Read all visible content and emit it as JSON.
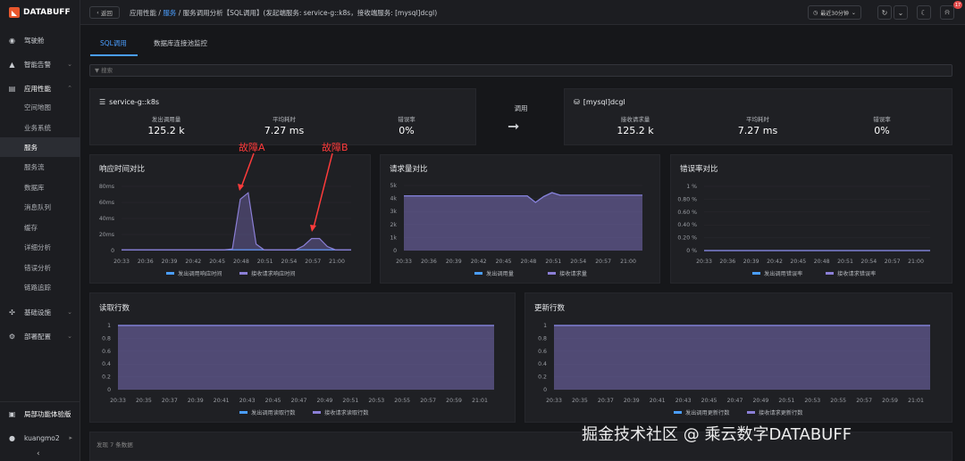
{
  "brand": {
    "name": "DATABUFF",
    "accent": "#e8572d"
  },
  "sidebar": {
    "items": [
      {
        "label": "驾驶舱",
        "icon": "gauge-icon"
      },
      {
        "label": "智能告警",
        "icon": "bell-icon"
      },
      {
        "label": "应用性能",
        "icon": "app-icon"
      },
      {
        "label": "空间地图"
      },
      {
        "label": "业务系统"
      },
      {
        "label": "服务"
      },
      {
        "label": "服务流"
      },
      {
        "label": "数据库"
      },
      {
        "label": "消息队列"
      },
      {
        "label": "缓存"
      },
      {
        "label": "详细分析"
      },
      {
        "label": "错误分析"
      },
      {
        "label": "链路追踪"
      },
      {
        "label": "基础设施",
        "icon": "infra-icon"
      },
      {
        "label": "部署配置",
        "icon": "gear-icon"
      }
    ],
    "trial": "局部功能体验版",
    "user": "kuangmo2"
  },
  "topbar": {
    "back_label": "返回",
    "crumb_1": "应用性能",
    "crumb_sep": "/",
    "crumb_2": "服务",
    "crumb_3": "服务调用分析【SQL调用】(发起端服务: service-g::k8s，接收端服务: [mysql]dcgl)",
    "time_range": "最近30分钟",
    "notif_count": "17"
  },
  "tabs": [
    {
      "label": "SQL调用"
    },
    {
      "label": "数据库连接池监控"
    }
  ],
  "search_placeholder": "搜索",
  "caller": {
    "name": "service-g::k8s",
    "m1_label": "发出调用量",
    "m1_value": "125.2 k",
    "m2_label": "平均耗时",
    "m2_value": "7.27 ms",
    "m3_label": "错误率",
    "m3_value": "0%"
  },
  "call_label": "调用",
  "callee": {
    "name": "[mysql]dcgl",
    "m1_label": "接收请求量",
    "m1_value": "125.2 k",
    "m2_label": "平均耗时",
    "m2_value": "7.27 ms",
    "m3_label": "错误率",
    "m3_value": "0%"
  },
  "annotations": {
    "a": "故障A",
    "b": "故障B"
  },
  "footer_note": "发现 7 条数据",
  "watermark": "掘金技术社区 @ 乘云数字DATABUFF",
  "chart_data": [
    {
      "type": "line",
      "title": "响应时间对比",
      "x": [
        "20:33",
        "20:36",
        "20:39",
        "20:42",
        "20:45",
        "20:48",
        "20:51",
        "20:54",
        "20:57",
        "21:00"
      ],
      "y_ticks": [
        "0",
        "20ms",
        "40ms",
        "60ms",
        "80ms"
      ],
      "ylim": [
        0,
        80
      ],
      "series": [
        {
          "name": "发出调用响应时间",
          "color": "#4a9eff",
          "values": [
            1,
            1,
            1,
            1,
            1,
            1,
            1,
            1,
            1,
            1,
            1,
            1,
            1,
            1,
            1,
            1,
            1,
            1,
            1,
            1,
            1,
            1,
            1,
            1,
            1,
            1,
            1,
            1,
            1,
            1
          ]
        },
        {
          "name": "接收请求响应时间",
          "color": "#8b7fd6",
          "values": [
            1,
            1,
            1,
            1,
            1,
            1,
            1,
            1,
            1,
            1,
            1,
            1,
            1,
            1,
            2,
            64,
            72,
            8,
            1,
            1,
            1,
            1,
            1,
            6,
            15,
            15,
            5,
            1,
            1,
            1
          ]
        }
      ]
    },
    {
      "type": "area",
      "title": "请求量对比",
      "x": [
        "20:33",
        "20:36",
        "20:39",
        "20:42",
        "20:45",
        "20:48",
        "20:51",
        "20:54",
        "20:57",
        "21:00"
      ],
      "y_ticks": [
        "0",
        "1k",
        "2k",
        "3k",
        "4k",
        "5k"
      ],
      "ylim": [
        0,
        5000
      ],
      "series": [
        {
          "name": "发出调用量",
          "color": "#4a9eff",
          "values": [
            4200,
            4200,
            4200,
            4200,
            4200,
            4200,
            4200,
            4200,
            4200,
            4200,
            4200,
            4200,
            4200,
            4200,
            4200,
            4200,
            3700,
            4150,
            4450,
            4250,
            4250,
            4250,
            4250,
            4250,
            4250,
            4250,
            4250,
            4250,
            4250,
            4250
          ]
        },
        {
          "name": "接收请求量",
          "color": "#8b7fd6",
          "values": [
            4200,
            4200,
            4200,
            4200,
            4200,
            4200,
            4200,
            4200,
            4200,
            4200,
            4200,
            4200,
            4200,
            4200,
            4200,
            4200,
            3700,
            4150,
            4450,
            4250,
            4250,
            4250,
            4250,
            4250,
            4250,
            4250,
            4250,
            4250,
            4250,
            4250
          ]
        }
      ]
    },
    {
      "type": "line",
      "title": "错误率对比",
      "x": [
        "20:33",
        "20:36",
        "20:39",
        "20:42",
        "20:45",
        "20:48",
        "20:51",
        "20:54",
        "20:57",
        "21:00"
      ],
      "y_ticks": [
        "0 %",
        "0.20 %",
        "0.40 %",
        "0.60 %",
        "0.80 %",
        "1 %"
      ],
      "ylim": [
        0,
        1
      ],
      "series": [
        {
          "name": "发出调用错误率",
          "color": "#4a9eff",
          "values": [
            0,
            0,
            0,
            0,
            0,
            0,
            0,
            0,
            0,
            0,
            0,
            0,
            0,
            0,
            0,
            0,
            0,
            0,
            0,
            0,
            0,
            0,
            0,
            0,
            0,
            0,
            0,
            0,
            0,
            0
          ]
        },
        {
          "name": "接收请求错误率",
          "color": "#8b7fd6",
          "values": [
            0,
            0,
            0,
            0,
            0,
            0,
            0,
            0,
            0,
            0,
            0,
            0,
            0,
            0,
            0,
            0,
            0,
            0,
            0,
            0,
            0,
            0,
            0,
            0,
            0,
            0,
            0,
            0,
            0,
            0
          ]
        }
      ]
    },
    {
      "type": "area",
      "title": "读取行数",
      "x": [
        "20:33",
        "20:35",
        "20:37",
        "20:39",
        "20:41",
        "20:43",
        "20:45",
        "20:47",
        "20:49",
        "20:51",
        "20:53",
        "20:55",
        "20:57",
        "20:59",
        "21:01"
      ],
      "y_ticks": [
        "0",
        "0.2",
        "0.4",
        "0.6",
        "0.8",
        "1"
      ],
      "ylim": [
        0,
        1
      ],
      "series": [
        {
          "name": "发出调用读取行数",
          "color": "#4a9eff",
          "values": [
            1,
            1,
            1,
            1,
            1,
            1,
            1,
            1,
            1,
            1,
            1,
            1,
            1,
            1,
            1,
            1,
            1,
            1,
            1,
            1,
            1,
            1,
            1,
            1,
            1,
            1,
            1,
            1,
            1,
            1
          ]
        },
        {
          "name": "接收请求读取行数",
          "color": "#8b7fd6",
          "values": [
            1,
            1,
            1,
            1,
            1,
            1,
            1,
            1,
            1,
            1,
            1,
            1,
            1,
            1,
            1,
            1,
            1,
            1,
            1,
            1,
            1,
            1,
            1,
            1,
            1,
            1,
            1,
            1,
            1,
            1
          ]
        }
      ]
    },
    {
      "type": "area",
      "title": "更新行数",
      "x": [
        "20:33",
        "20:35",
        "20:37",
        "20:39",
        "20:41",
        "20:43",
        "20:45",
        "20:47",
        "20:49",
        "20:51",
        "20:53",
        "20:55",
        "20:57",
        "20:59",
        "21:01"
      ],
      "y_ticks": [
        "0",
        "0.2",
        "0.4",
        "0.6",
        "0.8",
        "1"
      ],
      "ylim": [
        0,
        1
      ],
      "series": [
        {
          "name": "发出调用更新行数",
          "color": "#4a9eff",
          "values": [
            1,
            1,
            1,
            1,
            1,
            1,
            1,
            1,
            1,
            1,
            1,
            1,
            1,
            1,
            1,
            1,
            1,
            1,
            1,
            1,
            1,
            1,
            1,
            1,
            1,
            1,
            1,
            1,
            1,
            1
          ]
        },
        {
          "name": "接收请求更新行数",
          "color": "#8b7fd6",
          "values": [
            1,
            1,
            1,
            1,
            1,
            1,
            1,
            1,
            1,
            1,
            1,
            1,
            1,
            1,
            1,
            1,
            1,
            1,
            1,
            1,
            1,
            1,
            1,
            1,
            1,
            1,
            1,
            1,
            1,
            1
          ]
        }
      ]
    }
  ]
}
